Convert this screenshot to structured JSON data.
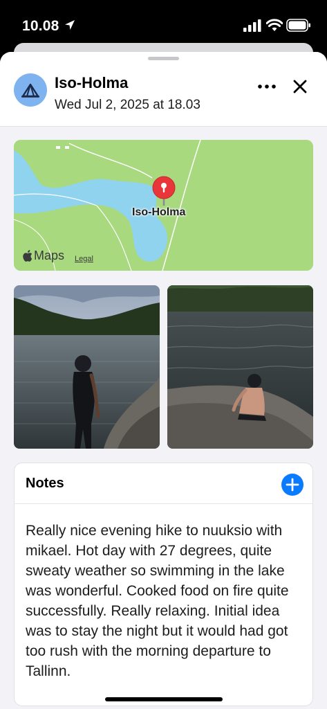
{
  "status_bar": {
    "time": "10.08"
  },
  "header": {
    "title": "Iso-Holma",
    "date": "Wed Jul 2, 2025 at 18.03",
    "avatar_icon": "tent-icon"
  },
  "map": {
    "pin_label": "Iso-Holma",
    "brand": "Maps",
    "legal": "Legal"
  },
  "photos": [
    {
      "description_icon": "lake-photo-1"
    },
    {
      "description_icon": "lake-photo-2"
    }
  ],
  "notes": {
    "title": "Notes",
    "body": "Really nice evening hike to nuuksio with mikael. Hot day with 27 degrees, quite sweaty weather so swimming in the lake was wonderful. Cooked food on fire quite successfully. Really relaxing. Initial idea was to stay the night but it would had got too rush with the morning departure to Tallinn."
  },
  "colors": {
    "accent": "#0a7aff",
    "avatar": "#7fb3ef",
    "map_land": "#a8d97f",
    "map_water": "#8fd3ee",
    "pin": "#e8363b"
  }
}
